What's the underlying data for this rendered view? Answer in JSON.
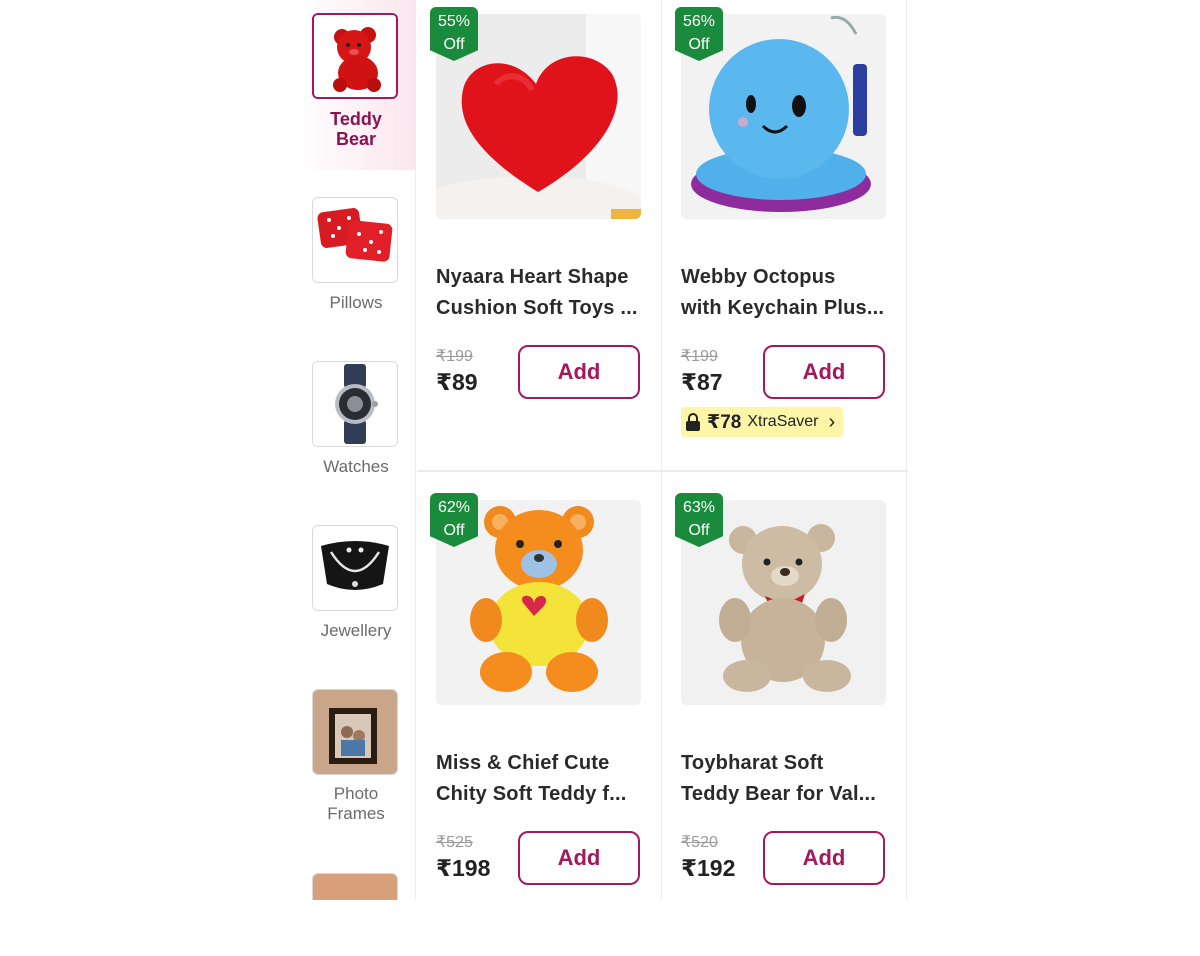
{
  "sidebar": {
    "items": [
      {
        "label_line1": "Teddy",
        "label_line2": "Bear",
        "active": true
      },
      {
        "label_line1": "Pillows",
        "label_line2": ""
      },
      {
        "label_line1": "Watches",
        "label_line2": ""
      },
      {
        "label_line1": "Jewellery",
        "label_line2": ""
      },
      {
        "label_line1": "Photo",
        "label_line2": "Frames"
      }
    ]
  },
  "products": [
    {
      "discount_pct": "55%",
      "discount_off": "Off",
      "name_line1": "Nyaara Heart Shape",
      "name_line2": "Cushion Soft Toys ...",
      "mrp": "₹199",
      "price": "₹89",
      "add_label": "Add"
    },
    {
      "discount_pct": "56%",
      "discount_off": "Off",
      "name_line1": "Webby Octopus",
      "name_line2": "with Keychain Plus...",
      "mrp": "₹199",
      "price": "₹87",
      "add_label": "Add",
      "xtrasaver": {
        "amount": "₹78",
        "label": "XtraSaver",
        "chevron": "›"
      }
    },
    {
      "discount_pct": "62%",
      "discount_off": "Off",
      "name_line1": "Miss & Chief Cute",
      "name_line2": "Chity Soft Teddy f...",
      "mrp": "₹525",
      "price": "₹198",
      "add_label": "Add"
    },
    {
      "discount_pct": "63%",
      "discount_off": "Off",
      "name_line1": "Toybharat Soft",
      "name_line2": "Teddy Bear for Val...",
      "mrp": "₹520",
      "price": "₹192",
      "add_label": "Add"
    }
  ],
  "colors": {
    "accent": "#a3195b",
    "badge": "#1a8a3c",
    "xtrasaver_bg": "#fdf6a8"
  }
}
